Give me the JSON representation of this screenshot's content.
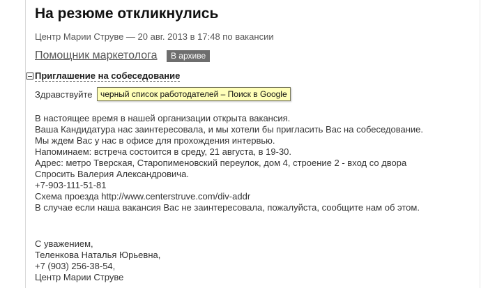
{
  "header": {
    "title": "На резюме откликнулись",
    "meta": "Центр Марии Струве — 20 авг. 2013 в 17:48 по вакансии"
  },
  "vacancy": {
    "link_label": "Помощник маркетолога",
    "badge": "В архиве"
  },
  "section": {
    "header": "Приглашение на собеседование"
  },
  "tooltip": {
    "text": "черный список работодателей – Поиск в Google"
  },
  "message": {
    "lines": [
      "Здравствуйте",
      "В настоящее время в нашей организации открыта вакансия.",
      "Ваша Кандидатура нас заинтересовала, и мы хотели бы пригласить Вас на собеседование.",
      "Мы ждем Вас у нас в офисе для прохождения интервью.",
      "Напоминаем: встреча состоится в среду, 21 августа, в 19-30.",
      "Адрес: метро Тверская, Старопименовский переулок, дом 4, строение 2 - вход со двора",
      "Спросить Валерия Александровича.",
      "+7-903-111-51-81",
      "Схема проезда http://www.centerstruve.com/div-addr",
      "В случае если наша вакансия Вас не заинтересовала, пожалуйста, сообщите нам об этом.",
      "С уважением,",
      "Теленкова Наталья Юрьевна,",
      "+7 (903) 256-38-54,",
      "Центр Марии Струве"
    ]
  }
}
